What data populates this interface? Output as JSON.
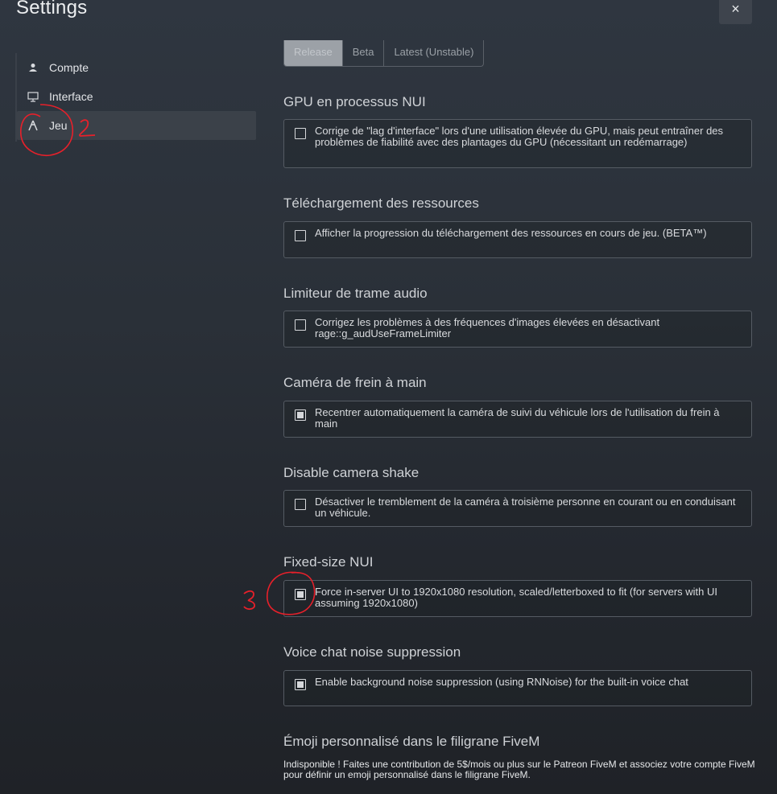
{
  "window": {
    "title": "Settings",
    "close_label": "×"
  },
  "sidebar": {
    "items": [
      {
        "label": "Compte",
        "icon": "user-icon"
      },
      {
        "label": "Interface",
        "icon": "monitor-icon"
      },
      {
        "label": "Jeu",
        "icon": "game-icon"
      }
    ]
  },
  "release_tabs": [
    "Release",
    "Beta",
    "Latest (Unstable)"
  ],
  "sections": [
    {
      "heading": "GPU en processus NUI",
      "text": "Corrige de \"lag d'interface\" lors d'une utilisation élevée du GPU, mais peut entraîner des problèmes de fiabilité avec des plantages du GPU (nécessitant un redémarrage)",
      "checked": false
    },
    {
      "heading": "Téléchargement des ressources",
      "text": "Afficher la progression du téléchargement des ressources en cours de jeu. (BETA™)",
      "checked": false
    },
    {
      "heading": "Limiteur de trame audio",
      "text": "Corrigez les problèmes à des fréquences d'images élevées en désactivant rage::g_audUseFrameLimiter",
      "checked": false
    },
    {
      "heading": "Caméra de frein à main",
      "text": "Recentrer automatiquement la caméra de suivi du véhicule lors de l'utilisation du frein à main",
      "checked": true
    },
    {
      "heading": "Disable camera shake",
      "text": "Désactiver le tremblement de la caméra à troisième personne en courant ou en conduisant un véhicule.",
      "checked": false
    },
    {
      "heading": "Fixed-size NUI",
      "text": "Force in-server UI to 1920x1080 resolution, scaled/letterboxed to fit (for servers with UI assuming 1920x1080)",
      "checked": true
    },
    {
      "heading": "Voice chat noise suppression",
      "text": "Enable background noise suppression (using RNNoise) for the built-in voice chat",
      "checked": true
    }
  ],
  "emoji": {
    "heading": "Émoji personnalisé dans le filigrane FiveM",
    "note": "Indisponible ! Faites une contribution de 5$/mois ou plus sur le Patreon FiveM et associez votre compte FiveM pour définir un emoji personnalisé dans le filigrane FiveM."
  },
  "annotations": {
    "mark_2": "2",
    "mark_3": "3",
    "color": "#e8202a"
  }
}
